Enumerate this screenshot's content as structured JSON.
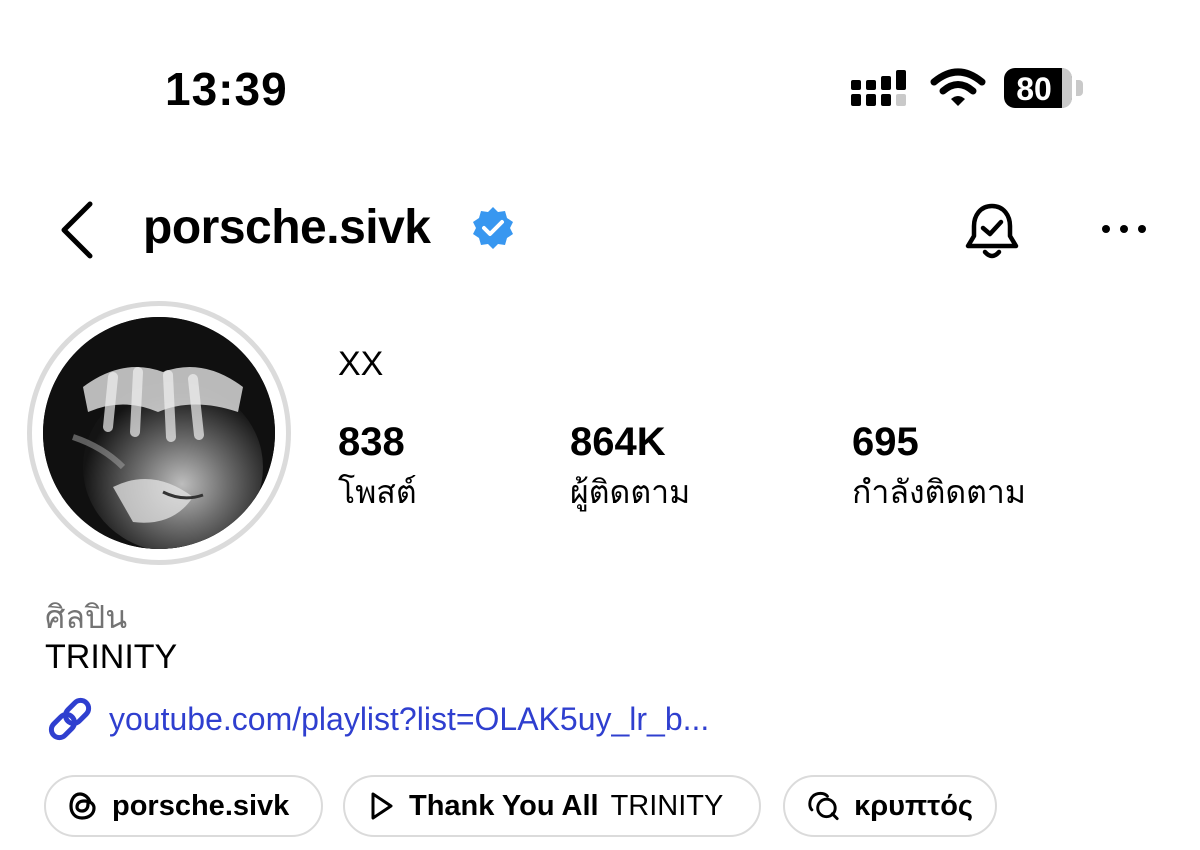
{
  "status_bar": {
    "time": "13:39",
    "battery_percent": "80"
  },
  "header": {
    "username": "porsche.sivk",
    "verified": true,
    "icons": [
      "chevron-left-icon",
      "verified-badge-icon",
      "bell-check-icon",
      "more-horizontal-icon"
    ]
  },
  "profile": {
    "display_name": "XX",
    "stats": [
      {
        "value": "838",
        "label": "โพสต์"
      },
      {
        "value": "864K",
        "label": "ผู้ติดตาม"
      },
      {
        "value": "695",
        "label": "กำลังติดตาม"
      }
    ],
    "category": "ศิลปิน",
    "bio": "TRINITY",
    "link": "youtube.com/playlist?list=OLAK5uy_lr_b..."
  },
  "chips": {
    "threads_label": "porsche.sivk",
    "music_song": "Thank You All",
    "music_artist": "TRINITY",
    "third_label": "κρυπτός"
  },
  "colors": {
    "link": "#2f3fcf",
    "verified": "#3897f0",
    "border": "#dbdbdb",
    "secondary_text": "#737373"
  }
}
